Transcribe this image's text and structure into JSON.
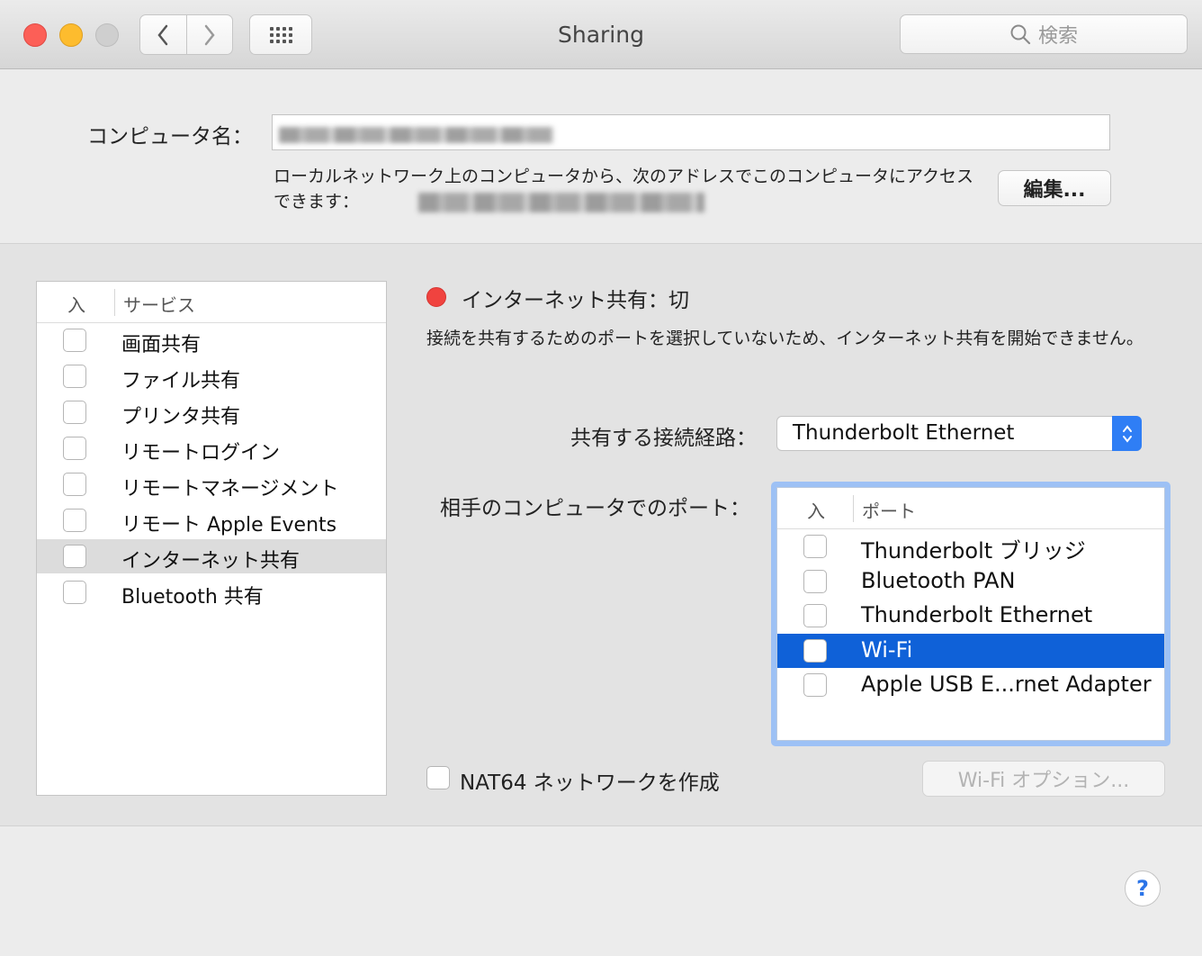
{
  "window": {
    "title": "Sharing"
  },
  "toolbar": {
    "search_placeholder": "検索"
  },
  "computer_name": {
    "label": "コンピュータ名：",
    "address_text": "ローカルネットワーク上のコンピュータから、次のアドレスでこのコンピュータにアクセスできます：",
    "edit_label": "編集..."
  },
  "services": {
    "header_on": "入",
    "header_service": "サービス",
    "items": [
      {
        "label": "画面共有",
        "checked": false,
        "selected": false
      },
      {
        "label": "ファイル共有",
        "checked": false,
        "selected": false
      },
      {
        "label": "プリンタ共有",
        "checked": false,
        "selected": false
      },
      {
        "label": "リモートログイン",
        "checked": false,
        "selected": false
      },
      {
        "label": "リモートマネージメント",
        "checked": false,
        "selected": false
      },
      {
        "label": "リモート Apple Events",
        "checked": false,
        "selected": false
      },
      {
        "label": "インターネット共有",
        "checked": false,
        "selected": true
      },
      {
        "label": "Bluetooth 共有",
        "checked": false,
        "selected": false
      }
    ]
  },
  "status": {
    "text": "インターネット共有：切",
    "color": "#f0433f",
    "description": "接続を共有するためのポートを選択していないため、インターネット共有を開始できません。"
  },
  "route": {
    "label": "共有する接続経路：",
    "value": "Thunderbolt Ethernet"
  },
  "ports": {
    "label": "相手のコンピュータでのポート：",
    "header_on": "入",
    "header_port": "ポート",
    "items": [
      {
        "label": "Thunderbolt ブリッジ",
        "checked": false,
        "selected": false
      },
      {
        "label": "Bluetooth PAN",
        "checked": false,
        "selected": false
      },
      {
        "label": "Thunderbolt Ethernet",
        "checked": false,
        "selected": false
      },
      {
        "label": "Wi-Fi",
        "checked": false,
        "selected": true
      },
      {
        "label": "Apple USB E...rnet Adapter",
        "checked": false,
        "selected": false
      }
    ]
  },
  "nat64": {
    "label": "NAT64 ネットワークを作成",
    "checked": false
  },
  "wifi_options": {
    "label": "Wi-Fi オプション..."
  },
  "help": {
    "label": "?"
  },
  "colors": {
    "accent": "#2f7ef5",
    "selection": "#0f61d8"
  }
}
